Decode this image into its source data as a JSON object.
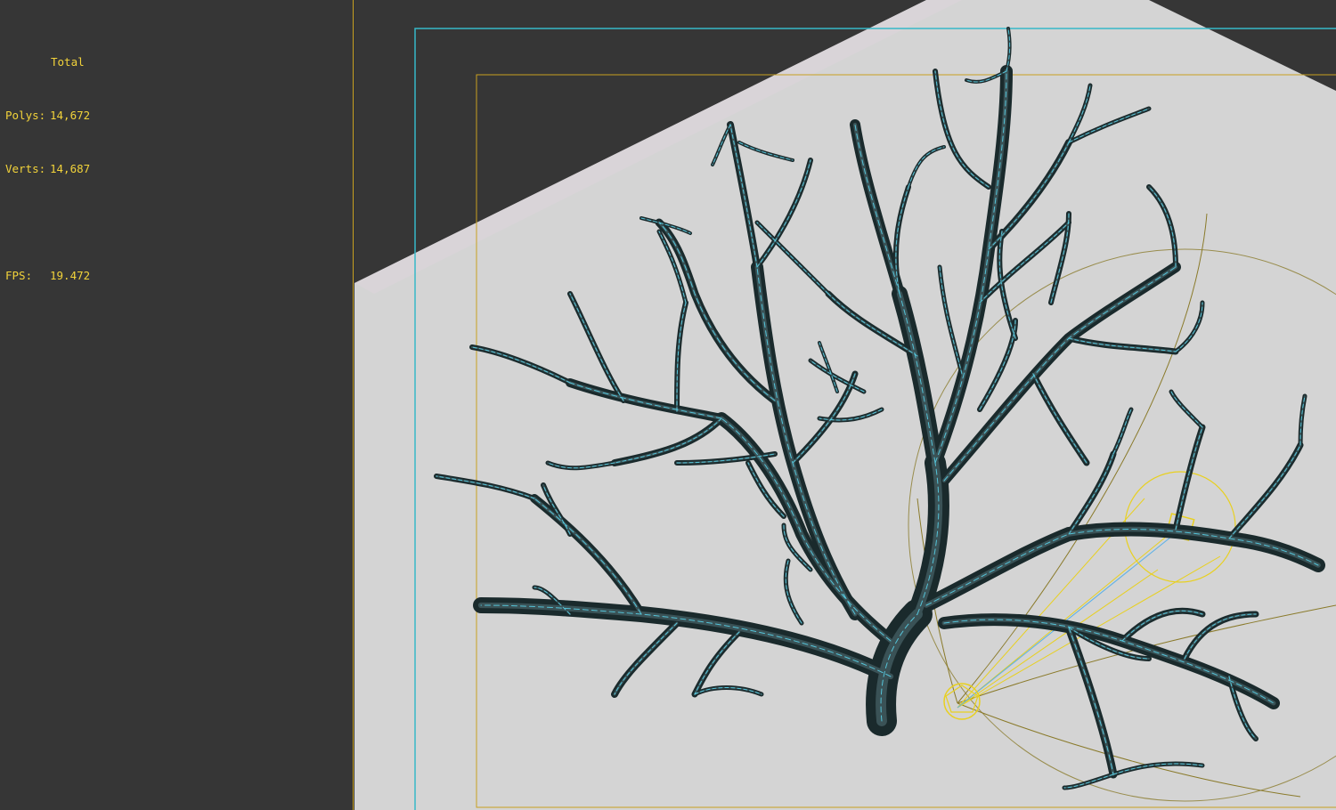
{
  "stats": {
    "header": "Total",
    "polys_label": "Polys:",
    "polys_value": "14,672",
    "verts_label": "Verts:",
    "verts_value": "14,687",
    "fps_label": "FPS:",
    "fps_value": "19.472"
  },
  "colors": {
    "viewport_background": "#363636",
    "ground_plane": "#d4d4d4",
    "ground_plane_far": "#d9d3d8",
    "safe_frame_outer": "#36b8c8",
    "safe_frame_inner": "#c8a020",
    "stats_text": "#f2d33a",
    "coral_dark": "#1a2a2c",
    "coral_wire": "#5ad8f0",
    "light_gizmo": "#e8d020"
  },
  "icons": {
    "light_gizmo": "spot-light-icon",
    "light_target": "light-target-icon"
  }
}
